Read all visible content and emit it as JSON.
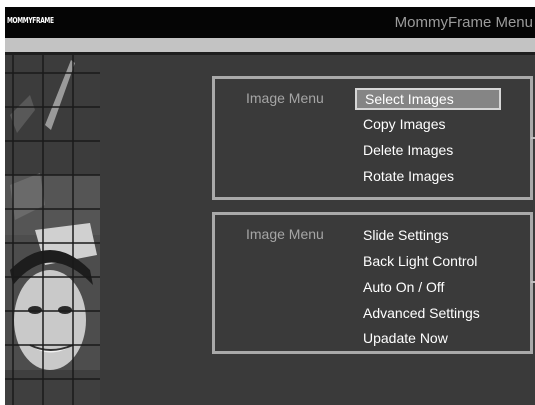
{
  "header": {
    "logo": "MOMMYFRAME",
    "title": "MommyFrame Menu"
  },
  "image_menu": {
    "label": "Image Menu",
    "items": [
      "Select Images",
      "Copy Images",
      "Delete Images",
      "Rotate Images"
    ],
    "selected": "Select Images"
  },
  "settings_menu": {
    "label": "Image Menu",
    "items": [
      "Slide Settings",
      "Back Light Control",
      "Auto On / Off",
      "Advanced Settings",
      "Upadate Now"
    ]
  },
  "colors": {
    "background": "#3a3a3a",
    "titlebar": "#050505",
    "panel_border": "#a9a9a9",
    "highlight": "#858585"
  }
}
